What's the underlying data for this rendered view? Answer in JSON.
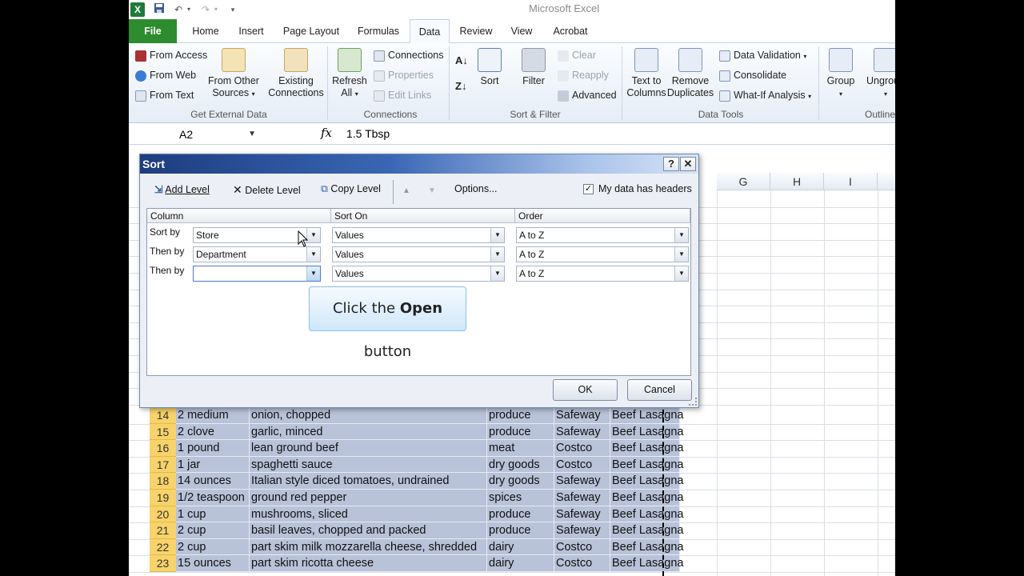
{
  "app_title": "Microsoft Excel",
  "tabs": [
    "File",
    "Home",
    "Insert",
    "Page Layout",
    "Formulas",
    "Data",
    "Review",
    "View",
    "Acrobat"
  ],
  "ribbon": {
    "get_external": {
      "from_access": "From Access",
      "from_web": "From Web",
      "from_text": "From Text",
      "other_sources_1": "From Other",
      "other_sources_2": "Sources",
      "existing_1": "Existing",
      "existing_2": "Connections",
      "label": "Get External Data"
    },
    "connections": {
      "refresh_1": "Refresh",
      "refresh_2": "All",
      "connections": "Connections",
      "properties": "Properties",
      "edit_links": "Edit Links",
      "label": "Connections"
    },
    "sort_filter": {
      "sort": "Sort",
      "filter": "Filter",
      "clear": "Clear",
      "reapply": "Reapply",
      "advanced": "Advanced",
      "label": "Sort & Filter"
    },
    "data_tools": {
      "text_to_1": "Text to",
      "text_to_2": "Columns",
      "remove_1": "Remove",
      "remove_2": "Duplicates",
      "validation": "Data Validation",
      "consolidate": "Consolidate",
      "whatif": "What-If Analysis",
      "label": "Data Tools"
    },
    "outline": {
      "group": "Group",
      "ungroup": "Ungroup",
      "label": "Outline"
    }
  },
  "formula_bar": {
    "name_box": "A2",
    "fx": "fx",
    "content": "1.5 Tbsp"
  },
  "columns": [
    "G",
    "H",
    "I"
  ],
  "rows": [
    {
      "num": "14",
      "qty": "2 medium",
      "item": "onion, chopped",
      "dept": "produce",
      "store": "Safeway",
      "recipe": "Beef Lasagna"
    },
    {
      "num": "15",
      "qty": "2 clove",
      "item": "garlic, minced",
      "dept": "produce",
      "store": "Safeway",
      "recipe": "Beef Lasagna"
    },
    {
      "num": "16",
      "qty": "1 pound",
      "item": "lean ground beef",
      "dept": "meat",
      "store": "Costco",
      "recipe": "Beef Lasagna"
    },
    {
      "num": "17",
      "qty": "1 jar",
      "item": "spaghetti sauce",
      "dept": "dry goods",
      "store": "Costco",
      "recipe": "Beef Lasagna"
    },
    {
      "num": "18",
      "qty": "14 ounces",
      "item": "Italian style diced tomatoes, undrained",
      "dept": "dry goods",
      "store": "Safeway",
      "recipe": "Beef Lasagna"
    },
    {
      "num": "19",
      "qty": "1/2 teaspoon",
      "item": "ground red pepper",
      "dept": "spices",
      "store": "Safeway",
      "recipe": "Beef Lasagna"
    },
    {
      "num": "20",
      "qty": "1 cup",
      "item": "mushrooms, sliced",
      "dept": "produce",
      "store": "Safeway",
      "recipe": "Beef Lasagna"
    },
    {
      "num": "21",
      "qty": "2 cup",
      "item": "basil leaves, chopped and packed",
      "dept": "produce",
      "store": "Safeway",
      "recipe": "Beef Lasagna"
    },
    {
      "num": "22",
      "qty": "2 cup",
      "item": "part skim milk mozzarella cheese, shredded",
      "dept": "dairy",
      "store": "Costco",
      "recipe": "Beef Lasagna"
    },
    {
      "num": "23",
      "qty": "15 ounces",
      "item": "part skim ricotta cheese",
      "dept": "dairy",
      "store": "Costco",
      "recipe": "Beef Lasagna"
    }
  ],
  "sort_dialog": {
    "title": "Sort",
    "help": "?",
    "close": "✕",
    "add_level": "Add Level",
    "delete_level": "Delete Level",
    "copy_level": "Copy Level",
    "options": "Options...",
    "headers_checkbox": "My data has headers",
    "col_header": "Column",
    "sorton_header": "Sort On",
    "order_header": "Order",
    "levels": [
      {
        "label": "Sort by",
        "column": "Store",
        "sort_on": "Values",
        "order": "A to Z"
      },
      {
        "label": "Then by",
        "column": "Department",
        "sort_on": "Values",
        "order": "A to Z"
      },
      {
        "label": "Then by",
        "column": "",
        "sort_on": "Values",
        "order": "A to Z"
      }
    ],
    "callout_pre": "Click the ",
    "callout_bold": "Open",
    "callout_post": " button",
    "ok": "OK",
    "cancel": "Cancel"
  }
}
